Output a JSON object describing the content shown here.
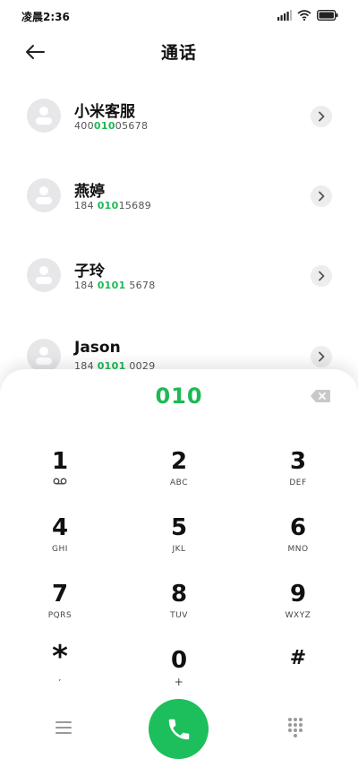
{
  "status_bar": {
    "time": "凌晨2:36",
    "icons": [
      "signal-icon",
      "wifi-icon",
      "battery-icon"
    ]
  },
  "header": {
    "title": "通话",
    "back_icon": "arrow-left-icon"
  },
  "contacts": [
    {
      "name": "小米客服",
      "number_parts": [
        {
          "t": "400",
          "h": false
        },
        {
          "t": "010",
          "h": true
        },
        {
          "t": "05678",
          "h": false
        }
      ]
    },
    {
      "name": "燕婷",
      "number_parts": [
        {
          "t": "184 ",
          "h": false
        },
        {
          "t": "010",
          "h": true
        },
        {
          "t": "15689",
          "h": false
        }
      ]
    },
    {
      "name": "子玲",
      "number_parts": [
        {
          "t": "184 ",
          "h": false
        },
        {
          "t": "0101",
          "h": true
        },
        {
          "t": " 5678",
          "h": false
        }
      ]
    },
    {
      "name": "Jason",
      "number_parts": [
        {
          "t": "184 ",
          "h": false
        },
        {
          "t": "0101",
          "h": true
        },
        {
          "t": " 0029",
          "h": false
        }
      ]
    }
  ],
  "dialpad": {
    "entered_number": "010",
    "keys": [
      {
        "digit": "1",
        "letters": "",
        "icon": "voicemail-icon"
      },
      {
        "digit": "2",
        "letters": "ABC"
      },
      {
        "digit": "3",
        "letters": "DEF"
      },
      {
        "digit": "4",
        "letters": "GHI"
      },
      {
        "digit": "5",
        "letters": "JKL"
      },
      {
        "digit": "6",
        "letters": "MNO"
      },
      {
        "digit": "7",
        "letters": "PQRS"
      },
      {
        "digit": "8",
        "letters": "TUV"
      },
      {
        "digit": "9",
        "letters": "WXYZ"
      },
      {
        "digit": "*",
        "letters": ","
      },
      {
        "digit": "0",
        "letters": "+"
      },
      {
        "digit": "#",
        "letters": ""
      }
    ]
  },
  "colors": {
    "accent": "#1db954",
    "call_button": "#1dbe5c"
  }
}
